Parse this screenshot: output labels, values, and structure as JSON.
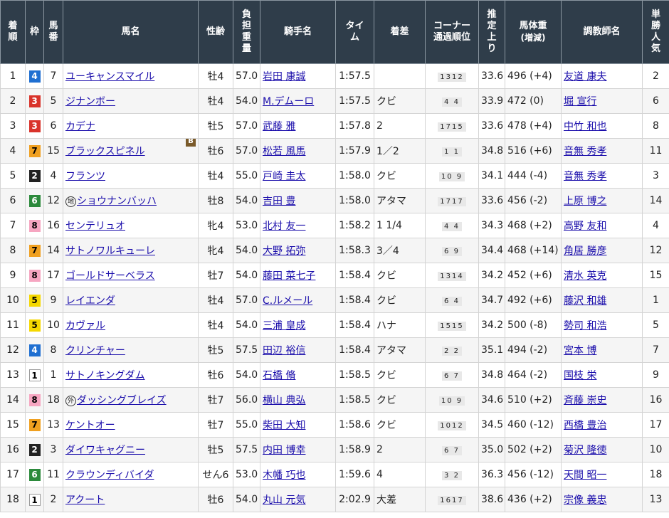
{
  "headers": {
    "rank": [
      "着",
      "順"
    ],
    "waku": "枠",
    "umaban": [
      "馬",
      "番"
    ],
    "horse": "馬名",
    "sexage": "性齢",
    "weight": [
      "負",
      "担",
      "重",
      "量"
    ],
    "jockey": "騎手名",
    "time": [
      "タイ",
      "ム"
    ],
    "margin": "着差",
    "corner": [
      "コーナー",
      "通過順位"
    ],
    "last3f": [
      "推",
      "定",
      "上",
      "り"
    ],
    "body": [
      "馬体重",
      "(増減)"
    ],
    "trainer": "調教師名",
    "pop": [
      "単",
      "勝",
      "人",
      "気"
    ]
  },
  "rows": [
    {
      "rank": "1",
      "waku": "4",
      "umaban": "7",
      "horse": "ユーキャンスマイル",
      "mark": "",
      "blinker": "",
      "sexage": "牡4",
      "weight": "57.0",
      "jockey": "岩田 康誠",
      "time": "1:57.5",
      "margin": "",
      "corner": "1312",
      "last3f": "33.6",
      "body": "496 (+4)",
      "trainer": "友道 康夫",
      "pop": "2"
    },
    {
      "rank": "2",
      "waku": "3",
      "umaban": "5",
      "horse": "ジナンボー",
      "mark": "",
      "blinker": "",
      "sexage": "牡4",
      "weight": "54.0",
      "jockey": "M.デムーロ",
      "time": "1:57.5",
      "margin": "クビ",
      "corner": "4 4",
      "last3f": "33.9",
      "body": "472 (0)",
      "trainer": "堀 宣行",
      "pop": "6"
    },
    {
      "rank": "3",
      "waku": "3",
      "umaban": "6",
      "horse": "カデナ",
      "mark": "",
      "blinker": "",
      "sexage": "牡5",
      "weight": "57.0",
      "jockey": "武藤 雅",
      "time": "1:57.8",
      "margin": "2",
      "corner": "1715",
      "last3f": "33.6",
      "body": "478 (+4)",
      "trainer": "中竹 和也",
      "pop": "8"
    },
    {
      "rank": "4",
      "waku": "7",
      "umaban": "15",
      "horse": "ブラックスピネル",
      "mark": "",
      "blinker": "B",
      "sexage": "牡6",
      "weight": "57.0",
      "jockey": "松若 風馬",
      "time": "1:57.9",
      "margin": "1／2",
      "corner": "1 1",
      "last3f": "34.8",
      "body": "516 (+6)",
      "trainer": "音無 秀孝",
      "pop": "11"
    },
    {
      "rank": "5",
      "waku": "2",
      "umaban": "4",
      "horse": "フランツ",
      "mark": "",
      "blinker": "",
      "sexage": "牡4",
      "weight": "55.0",
      "jockey": "戸崎 圭太",
      "time": "1:58.0",
      "margin": "クビ",
      "corner": "10 9",
      "last3f": "34.1",
      "body": "444 (-4)",
      "trainer": "音無 秀孝",
      "pop": "3"
    },
    {
      "rank": "6",
      "waku": "6",
      "umaban": "12",
      "horse": "ショウナンバッハ",
      "mark": "地",
      "blinker": "",
      "sexage": "牡8",
      "weight": "54.0",
      "jockey": "吉田 豊",
      "time": "1:58.0",
      "margin": "アタマ",
      "corner": "1717",
      "last3f": "33.6",
      "body": "456 (-2)",
      "trainer": "上原 博之",
      "pop": "14"
    },
    {
      "rank": "7",
      "waku": "8",
      "umaban": "16",
      "horse": "センテリュオ",
      "mark": "",
      "blinker": "",
      "sexage": "牝4",
      "weight": "53.0",
      "jockey": "北村 友一",
      "time": "1:58.2",
      "margin": "1 1/4",
      "corner": "4 4",
      "last3f": "34.3",
      "body": "468 (+2)",
      "trainer": "高野 友和",
      "pop": "4"
    },
    {
      "rank": "8",
      "waku": "7",
      "umaban": "14",
      "horse": "サトノワルキューレ",
      "mark": "",
      "blinker": "",
      "sexage": "牝4",
      "weight": "54.0",
      "jockey": "大野 拓弥",
      "time": "1:58.3",
      "margin": "3／4",
      "corner": "6 9",
      "last3f": "34.4",
      "body": "468 (+14)",
      "trainer": "角居 勝彦",
      "pop": "12"
    },
    {
      "rank": "9",
      "waku": "8",
      "umaban": "17",
      "horse": "ゴールドサーベラス",
      "mark": "",
      "blinker": "",
      "sexage": "牡7",
      "weight": "54.0",
      "jockey": "藤田 菜七子",
      "time": "1:58.4",
      "margin": "クビ",
      "corner": "1314",
      "last3f": "34.2",
      "body": "452 (+6)",
      "trainer": "清水 英克",
      "pop": "15"
    },
    {
      "rank": "10",
      "waku": "5",
      "umaban": "9",
      "horse": "レイエンダ",
      "mark": "",
      "blinker": "",
      "sexage": "牡4",
      "weight": "57.0",
      "jockey": "C.ルメール",
      "time": "1:58.4",
      "margin": "クビ",
      "corner": "6 4",
      "last3f": "34.7",
      "body": "492 (+6)",
      "trainer": "藤沢 和雄",
      "pop": "1"
    },
    {
      "rank": "11",
      "waku": "5",
      "umaban": "10",
      "horse": "カヴァル",
      "mark": "",
      "blinker": "",
      "sexage": "牡4",
      "weight": "54.0",
      "jockey": "三浦 皇成",
      "time": "1:58.4",
      "margin": "ハナ",
      "corner": "1515",
      "last3f": "34.2",
      "body": "500 (-8)",
      "trainer": "勢司 和浩",
      "pop": "5"
    },
    {
      "rank": "12",
      "waku": "4",
      "umaban": "8",
      "horse": "クリンチャー",
      "mark": "",
      "blinker": "",
      "sexage": "牡5",
      "weight": "57.5",
      "jockey": "田辺 裕信",
      "time": "1:58.4",
      "margin": "アタマ",
      "corner": "2 2",
      "last3f": "35.1",
      "body": "494 (-2)",
      "trainer": "宮本 博",
      "pop": "7"
    },
    {
      "rank": "13",
      "waku": "1",
      "umaban": "1",
      "horse": "サトノキングダム",
      "mark": "",
      "blinker": "",
      "sexage": "牡6",
      "weight": "54.0",
      "jockey": "石橋 脩",
      "time": "1:58.5",
      "margin": "クビ",
      "corner": "6 7",
      "last3f": "34.8",
      "body": "464 (-2)",
      "trainer": "国枝 栄",
      "pop": "9"
    },
    {
      "rank": "14",
      "waku": "8",
      "umaban": "18",
      "horse": "ダッシングブレイズ",
      "mark": "外",
      "blinker": "",
      "sexage": "牡7",
      "weight": "56.0",
      "jockey": "横山 典弘",
      "time": "1:58.5",
      "margin": "クビ",
      "corner": "10 9",
      "last3f": "34.6",
      "body": "510 (+2)",
      "trainer": "斉藤 崇史",
      "pop": "16"
    },
    {
      "rank": "15",
      "waku": "7",
      "umaban": "13",
      "horse": "ケントオー",
      "mark": "",
      "blinker": "",
      "sexage": "牡7",
      "weight": "55.0",
      "jockey": "柴田 大知",
      "time": "1:58.6",
      "margin": "クビ",
      "corner": "1012",
      "last3f": "34.5",
      "body": "460 (-12)",
      "trainer": "西橋 豊治",
      "pop": "17"
    },
    {
      "rank": "16",
      "waku": "2",
      "umaban": "3",
      "horse": "ダイワキャグニー",
      "mark": "",
      "blinker": "",
      "sexage": "牡5",
      "weight": "57.5",
      "jockey": "内田 博幸",
      "time": "1:58.9",
      "margin": "2",
      "corner": "6 7",
      "last3f": "35.0",
      "body": "502 (+2)",
      "trainer": "菊沢 隆徳",
      "pop": "10"
    },
    {
      "rank": "17",
      "waku": "6",
      "umaban": "11",
      "horse": "クラウンディバイダ",
      "mark": "",
      "blinker": "",
      "sexage": "せん6",
      "weight": "53.0",
      "jockey": "木幡 巧也",
      "time": "1:59.6",
      "margin": "4",
      "corner": "3 2",
      "last3f": "36.3",
      "body": "456 (-12)",
      "trainer": "天間 昭一",
      "pop": "18"
    },
    {
      "rank": "18",
      "waku": "1",
      "umaban": "2",
      "horse": "アクート",
      "mark": "",
      "blinker": "",
      "sexage": "牡6",
      "weight": "54.0",
      "jockey": "丸山 元気",
      "time": "2:02.9",
      "margin": "大差",
      "corner": "1617",
      "last3f": "38.6",
      "body": "436 (+2)",
      "trainer": "宗像 義忠",
      "pop": "13"
    }
  ]
}
